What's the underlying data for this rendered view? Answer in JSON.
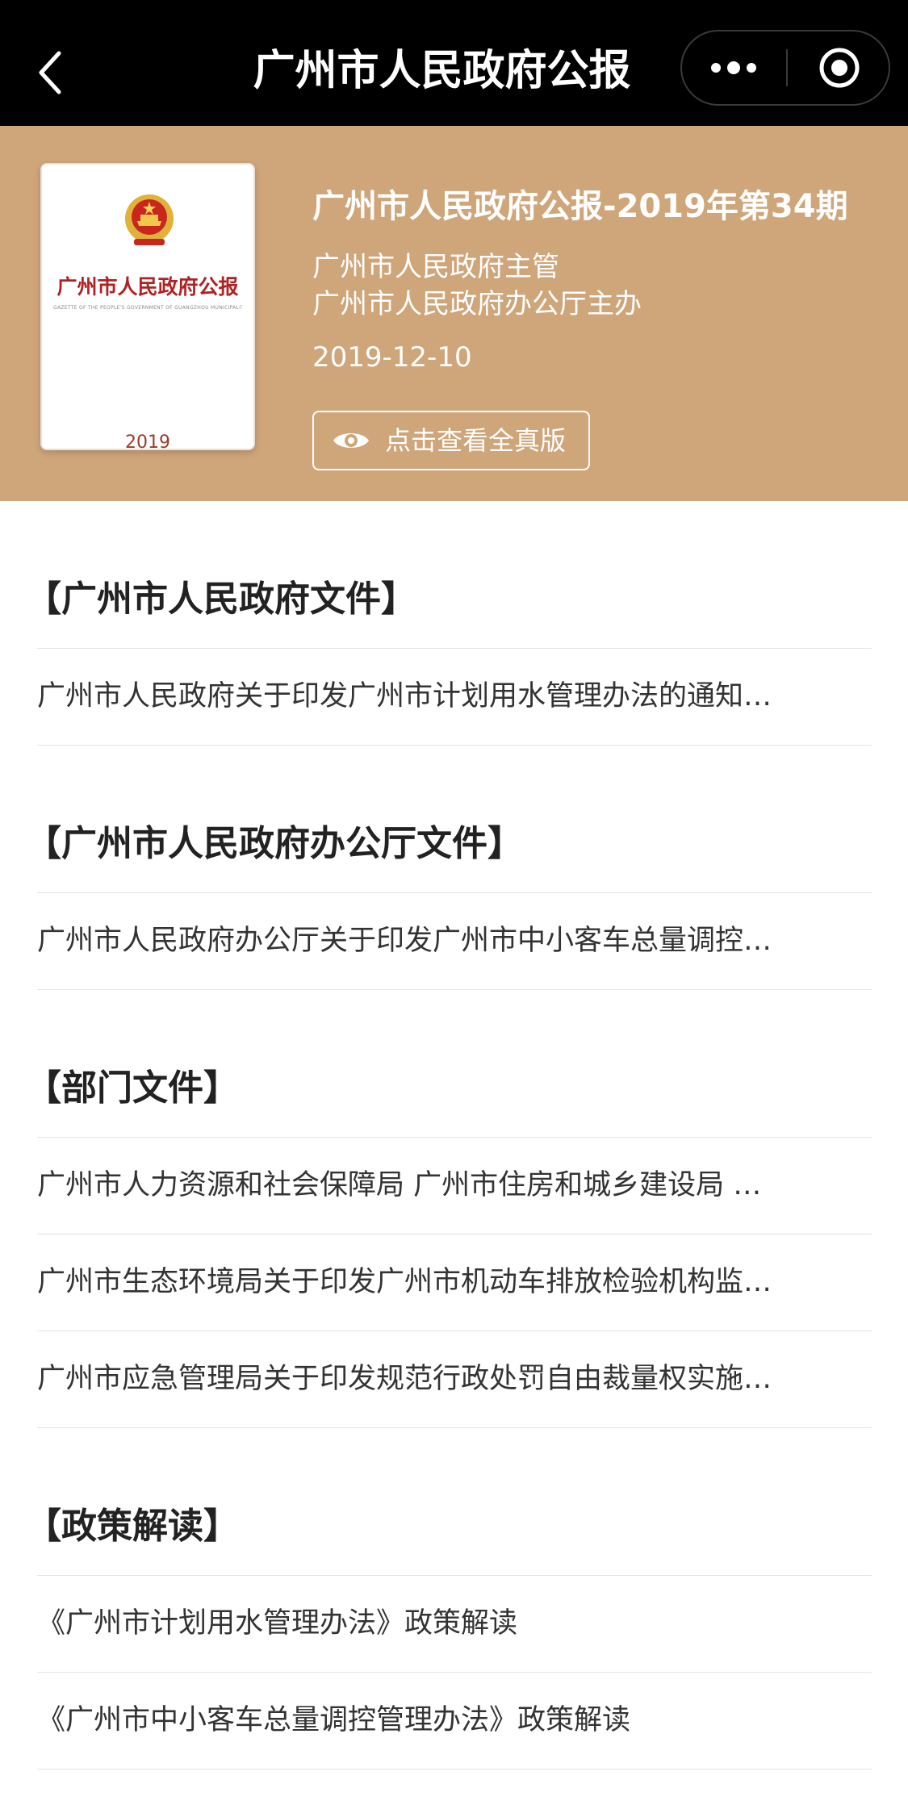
{
  "navbar": {
    "title": "广州市人民政府公报",
    "back_icon": "chevron-left-icon",
    "more_icon": "more-dots-icon",
    "close_icon": "target-close-icon"
  },
  "header": {
    "cover": {
      "title": "广州市人民政府公报",
      "subtitle": "GAZETTE OF THE PEOPLE'S GOVERNMENT OF GUANGZHOU MUNICIPALITY",
      "year": "2019"
    },
    "issue_title": "广州市人民政府公报-2019年第34期",
    "supervisor": "广州市人民政府主管",
    "sponsor": "广州市人民政府办公厅主办",
    "date": "2019-12-10",
    "view_button_label": "点击查看全真版",
    "view_button_icon": "eye-icon"
  },
  "sections": [
    {
      "title": "【广州市人民政府文件】",
      "items": [
        "广州市人民政府关于印发广州市计划用水管理办法的通知…"
      ]
    },
    {
      "title": "【广州市人民政府办公厅文件】",
      "items": [
        "广州市人民政府办公厅关于印发广州市中小客车总量调控…"
      ]
    },
    {
      "title": "【部门文件】",
      "items": [
        "广州市人力资源和社会保障局 广州市住房和城乡建设局 …",
        "广州市生态环境局关于印发广州市机动车排放检验机构监…",
        "广州市应急管理局关于印发规范行政处罚自由裁量权实施…"
      ]
    },
    {
      "title": "【政策解读】",
      "items": [
        "《广州市计划用水管理办法》政策解读",
        "《广州市中小客车总量调控管理办法》政策解读"
      ]
    }
  ],
  "colors": {
    "navbar_bg": "#000000",
    "banner_bg": "#cfa57a",
    "cover_title_red": "#b02222",
    "text_dark": "#222222"
  }
}
